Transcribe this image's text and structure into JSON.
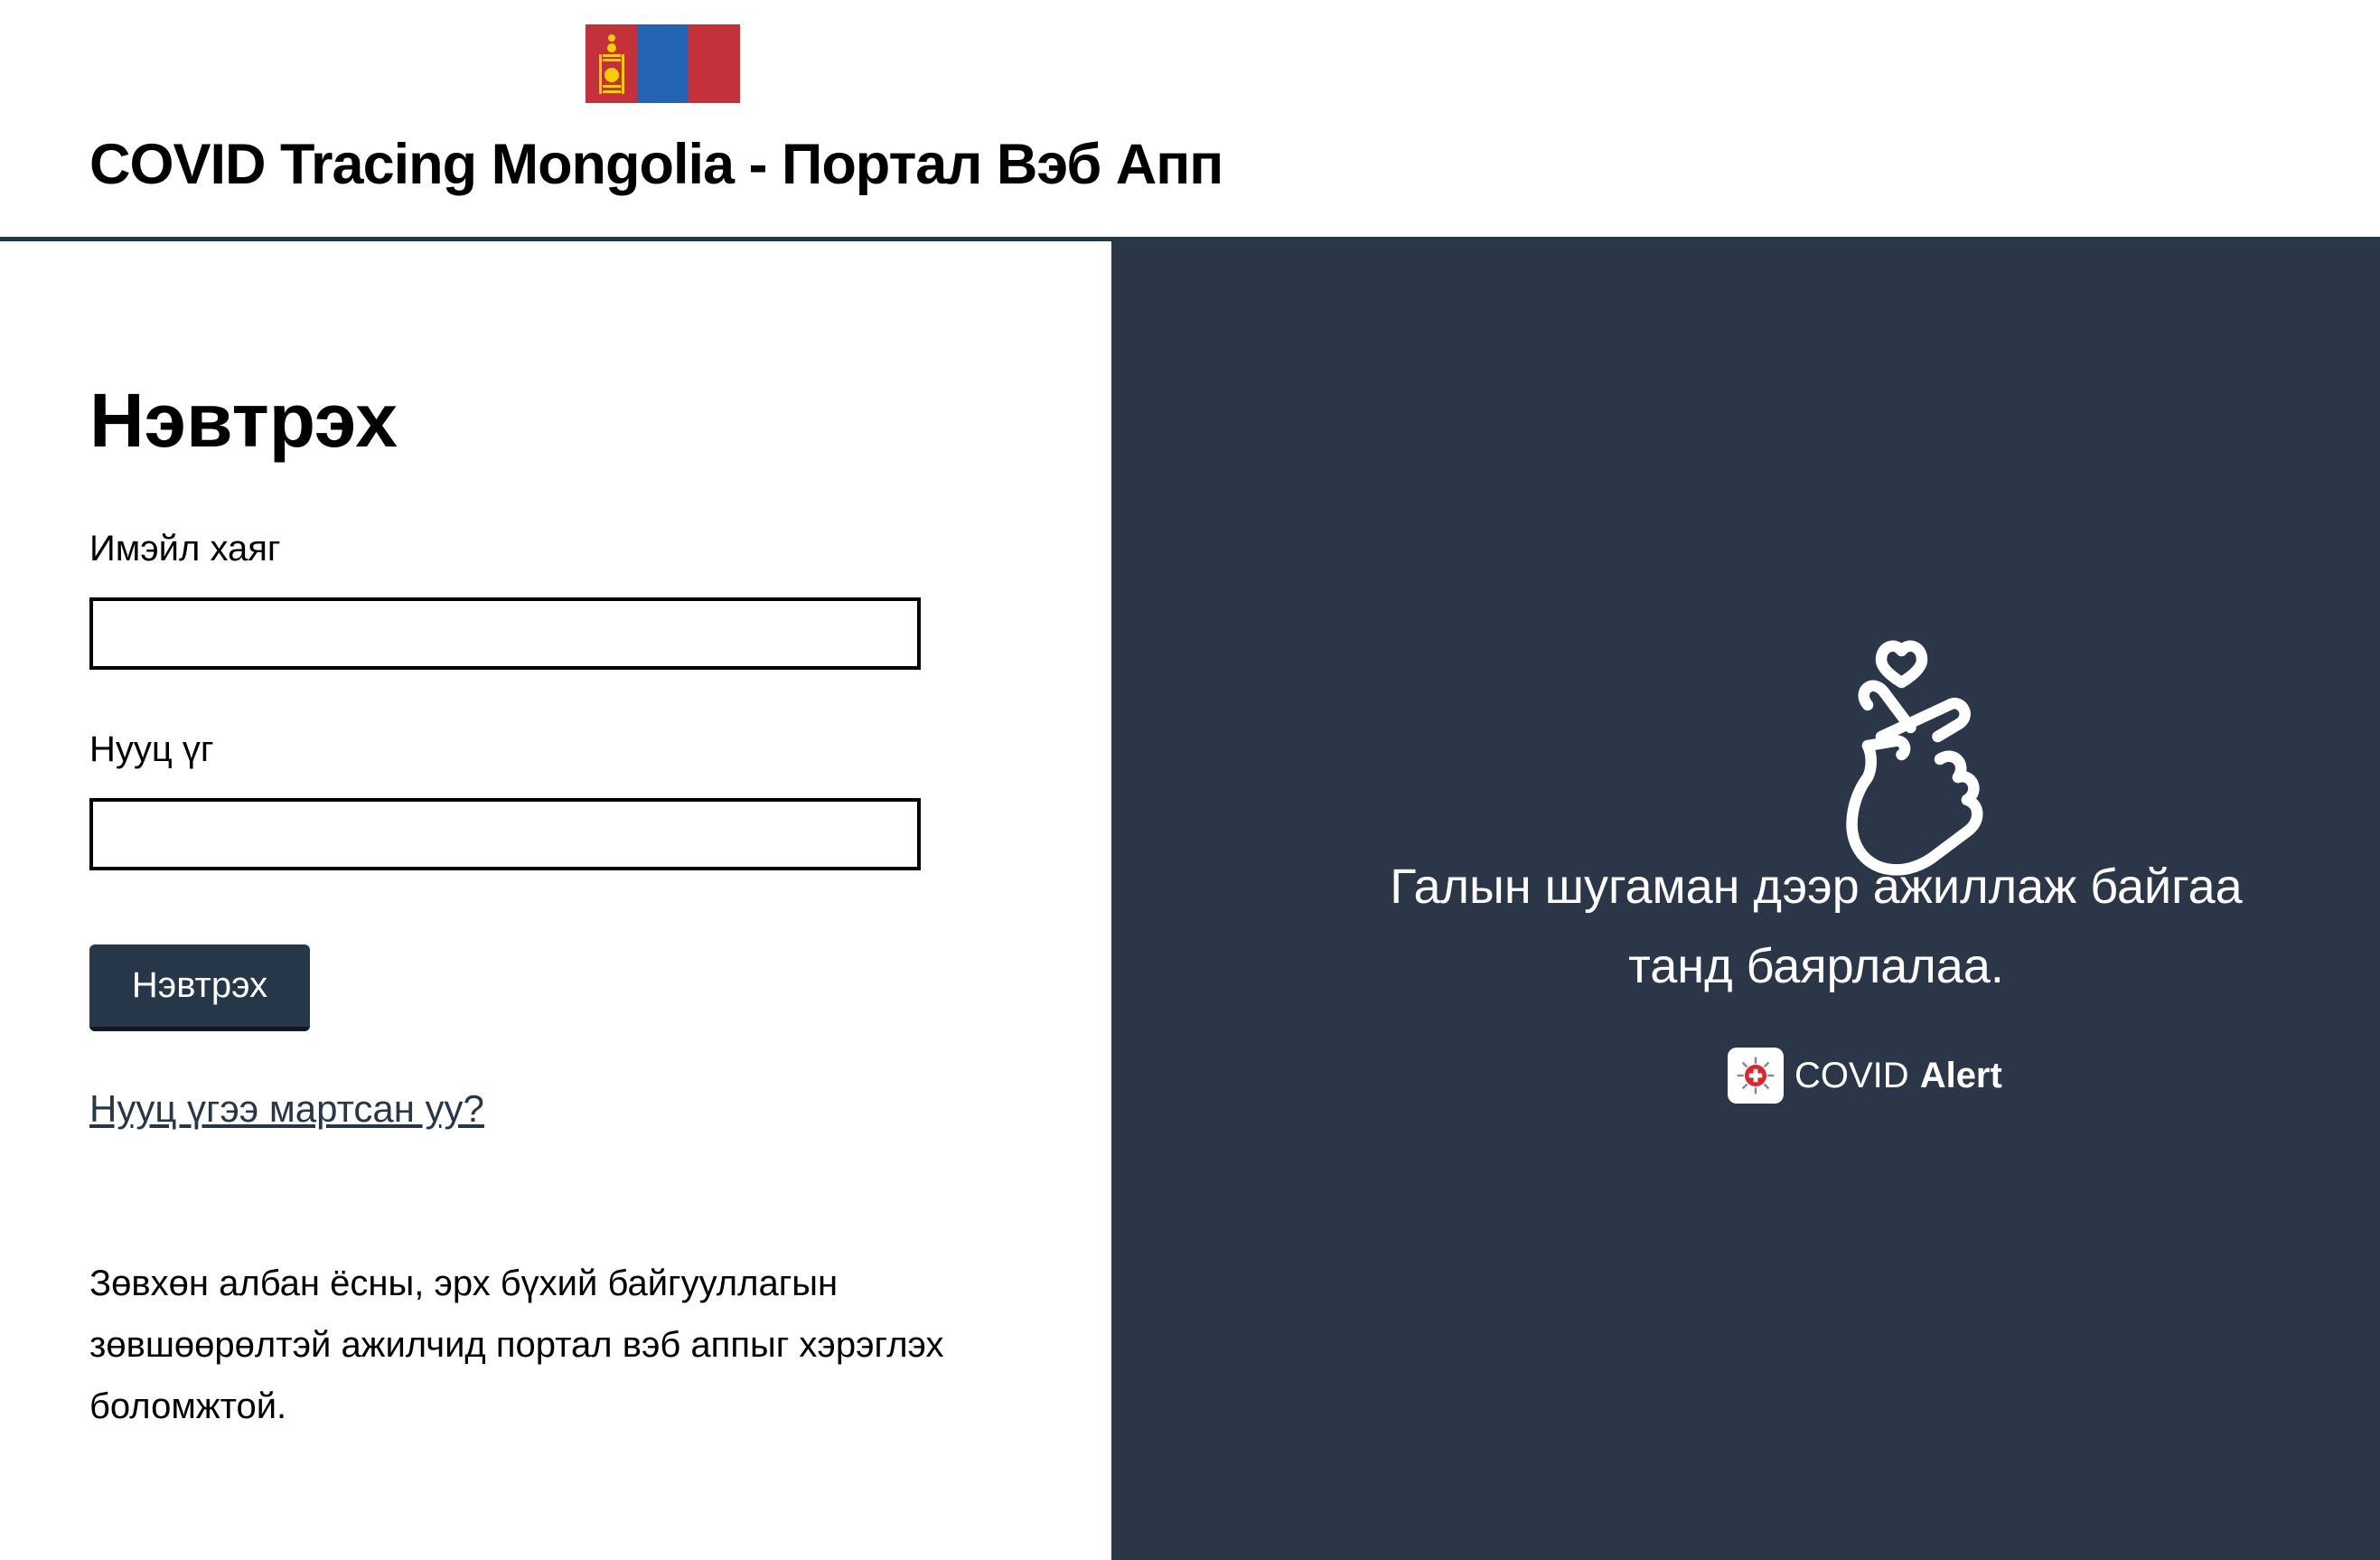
{
  "header": {
    "title": "COVID Tracing Mongolia - Портал Вэб Апп",
    "flag_colors": [
      "#c4313a",
      "#2364b4",
      "#c4313a"
    ]
  },
  "login": {
    "heading": "Нэвтрэх",
    "email_label": "Имэйл хаяг",
    "email_value": "",
    "password_label": "Нууц үг",
    "password_value": "",
    "submit_label": "Нэвтрэх",
    "forgot_link": "Нууц үгээ мартсан уу?",
    "notice": "Зөвхөн албан ёсны, эрх бүхий байгууллагын зөвшөөрөлтэй ажилчид портал вэб аппыг хэрэглэх боломжтой."
  },
  "side": {
    "icon": "finger-heart-icon",
    "message": "Галын шугаман дээр ажиллаж байгаа танд баярлалаа.",
    "brand_icon": "covid-alert-logo-icon",
    "brand_regular": "COVID",
    "brand_bold": "Alert",
    "background": "#2b3749"
  },
  "theme": {
    "accent": "#26374a"
  }
}
